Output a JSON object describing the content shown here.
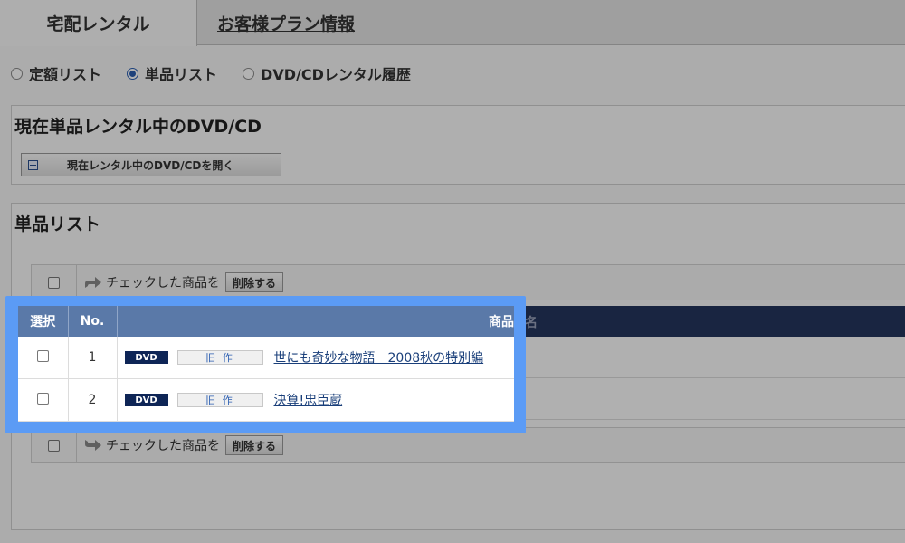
{
  "tabs": {
    "rental": "宅配レンタル",
    "plan": "お客様プラン情報"
  },
  "radios": [
    {
      "label": "定額リスト",
      "checked": false
    },
    {
      "label": "単品リスト",
      "checked": true
    },
    {
      "label": "DVD/CDレンタル履歴",
      "checked": false
    }
  ],
  "current_section": {
    "title": "現在単品レンタル中のDVD/CD",
    "open_button": "現在レンタル中のDVD/CDを開く"
  },
  "list_section": {
    "title": "単品リスト",
    "action_text": "チェックした商品を",
    "delete_button": "削除する"
  },
  "table": {
    "headers": {
      "select": "選択",
      "no": "No.",
      "name": "商品",
      "name_tail": "名"
    },
    "rows": [
      {
        "no": "1",
        "media": "DVD",
        "category": "旧 作",
        "title": "世にも奇妙な物語　2008秋の特別編"
      },
      {
        "no": "2",
        "media": "DVD",
        "category": "旧 作",
        "title": "決算!忠臣蔵"
      }
    ]
  },
  "colors": {
    "highlight": "#5b9bf5",
    "header_bg": "#5a79a8",
    "dvd_badge": "#0e2556",
    "link": "#1a3f7a"
  }
}
